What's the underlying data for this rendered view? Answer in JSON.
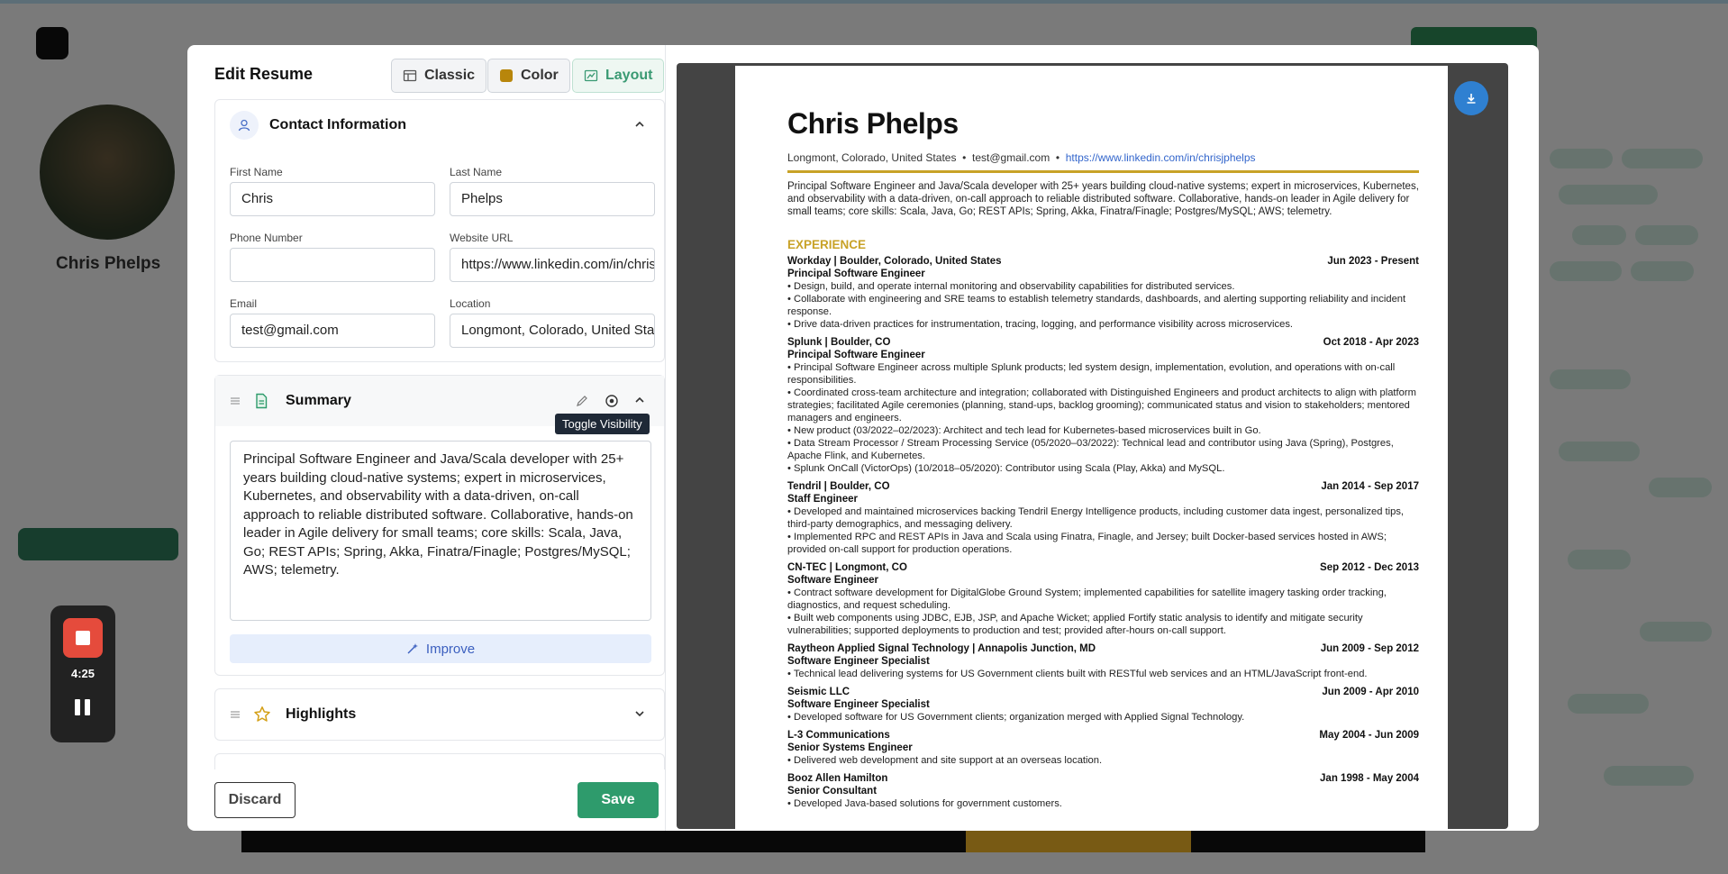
{
  "modal": {
    "title": "Edit Resume",
    "toolbar": {
      "classic": "Classic",
      "color": "Color",
      "layout": "Layout"
    },
    "discard": "Discard",
    "save": "Save"
  },
  "contact": {
    "title": "Contact Information",
    "first_name_label": "First Name",
    "first_name": "Chris",
    "last_name_label": "Last Name",
    "last_name": "Phelps",
    "phone_label": "Phone Number",
    "phone": "",
    "website_label": "Website URL",
    "website": "https://www.linkedin.com/in/chrisjphelps",
    "email_label": "Email",
    "email": "test@gmail.com",
    "location_label": "Location",
    "location": "Longmont, Colorado, United States"
  },
  "summary": {
    "title": "Summary",
    "text": "Principal Software Engineer and Java/Scala developer with 25+ years building cloud-native systems; expert in microservices, Kubernetes, and observability with a data-driven, on-call approach to reliable distributed software. Collaborative, hands-on leader in Agile delivery for small teams; core skills: Scala, Java, Go; REST APIs; Spring, Akka, Finatra/Finagle; Postgres/MySQL; AWS; telemetry.",
    "improve": "Improve",
    "tooltip": "Toggle Visibility"
  },
  "highlights": {
    "title": "Highlights"
  },
  "recorder": {
    "time": "4:25"
  },
  "resume": {
    "name": "Chris Phelps",
    "location": "Longmont, Colorado, United States",
    "email": "test@gmail.com",
    "link": "https://www.linkedin.com/in/chrisjphelps",
    "summary": "Principal Software Engineer and Java/Scala developer with 25+ years building cloud-native systems; expert in microservices, Kubernetes, and observability with a data-driven, on-call approach to reliable distributed software. Collaborative, hands-on leader in Agile delivery for small teams; core skills: Scala, Java, Go; REST APIs; Spring, Akka, Finatra/Finagle; Postgres/MySQL; AWS; telemetry.",
    "experience_heading": "EXPERIENCE",
    "jobs": [
      {
        "company": "Workday  | Boulder, Colorado, United States",
        "dates": "Jun 2023 - Present",
        "title": "Principal Software Engineer",
        "bullets": [
          "• Design, build, and operate internal monitoring and observability capabilities for distributed services.",
          "• Collaborate with engineering and SRE teams to establish telemetry standards, dashboards, and alerting supporting reliability and incident response.",
          "• Drive data-driven practices for instrumentation, tracing, logging, and performance visibility across microservices."
        ]
      },
      {
        "company": "Splunk  | Boulder, CO",
        "dates": "Oct 2018 - Apr 2023",
        "title": "Principal Software Engineer",
        "bullets": [
          "• Principal Software Engineer across multiple Splunk products; led system design, implementation, evolution, and operations with on-call responsibilities.",
          "• Coordinated cross-team architecture and integration; collaborated with Distinguished Engineers and product architects to align with platform strategies; facilitated Agile ceremonies (planning, stand-ups, backlog grooming); communicated status and vision to stakeholders; mentored managers and engineers.",
          "• New product (03/2022–02/2023): Architect and tech lead for Kubernetes-based microservices built in Go.",
          "• Data Stream Processor / Stream Processing Service (05/2020–03/2022): Technical lead and contributor using Java (Spring), Postgres, Apache Flink, and Kubernetes.",
          "• Splunk OnCall (VictorOps) (10/2018–05/2020): Contributor using Scala (Play, Akka) and MySQL."
        ]
      },
      {
        "company": "Tendril  | Boulder, CO",
        "dates": "Jan 2014 - Sep 2017",
        "title": "Staff Engineer",
        "bullets": [
          "• Developed and maintained microservices backing Tendril Energy Intelligence products, including customer data ingest, personalized tips, third-party demographics, and messaging delivery.",
          "• Implemented RPC and REST APIs in Java and Scala using Finatra, Finagle, and Jersey; built Docker-based services hosted in AWS; provided on-call support for production operations."
        ]
      },
      {
        "company": "CN-TEC  | Longmont, CO",
        "dates": "Sep 2012 - Dec 2013",
        "title": "Software Engineer",
        "bullets": [
          "• Contract software development for DigitalGlobe Ground System; implemented capabilities for satellite imagery tasking order tracking, diagnostics, and request scheduling.",
          "• Built web components using JDBC, EJB, JSP, and Apache Wicket; applied Fortify static analysis to identify and mitigate security vulnerabilities; supported deployments to production and test; provided after-hours on-call support."
        ]
      },
      {
        "company": "Raytheon Applied Signal Technology  | Annapolis Junction, MD",
        "dates": "Jun 2009 - Sep 2012",
        "title": "Software Engineer Specialist",
        "bullets": [
          "• Technical lead delivering systems for US Government clients built with RESTful web services and an HTML/JavaScript front-end."
        ]
      },
      {
        "company": "Seismic LLC",
        "dates": "Jun 2009 - Apr 2010",
        "title": "Software Engineer Specialist",
        "bullets": [
          "• Developed software for US Government clients; organization merged with Applied Signal Technology."
        ]
      },
      {
        "company": "L-3 Communications",
        "dates": "May 2004 - Jun 2009",
        "title": "Senior Systems Engineer",
        "bullets": [
          "• Delivered web development and site support at an overseas location."
        ]
      },
      {
        "company": "Booz Allen Hamilton",
        "dates": "Jan 1998 - May 2004",
        "title": "Senior Consultant",
        "bullets": [
          "• Developed Java-based solutions for government customers."
        ]
      }
    ]
  }
}
